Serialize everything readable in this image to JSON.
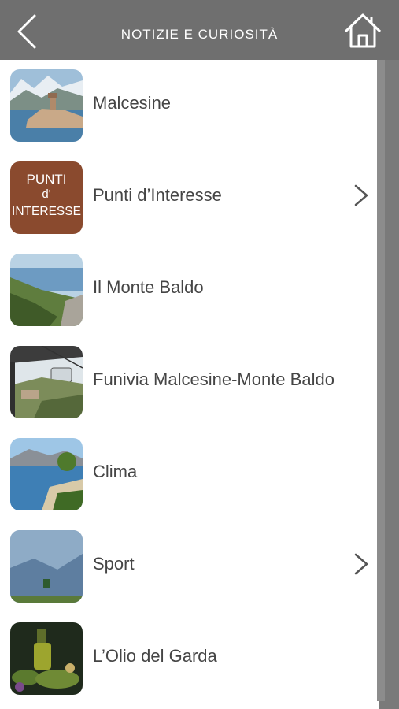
{
  "header": {
    "title": "NOTIZIE E CURIOSITÀ",
    "back_icon": "chevron-left-icon",
    "home_icon": "home-icon"
  },
  "colors": {
    "header_bg": "#6f6f6f",
    "text": "#454545",
    "accent_brown": "#8a4a2e"
  },
  "items": [
    {
      "label": "Malcesine",
      "has_chevron": false
    },
    {
      "label": "Punti d’Interesse",
      "has_chevron": true,
      "thumb_text": [
        "PUNTI",
        "d'",
        "INTERESSE"
      ]
    },
    {
      "label": "Il Monte Baldo",
      "has_chevron": false
    },
    {
      "label": "Funivia Malcesine-Monte Baldo",
      "has_chevron": false
    },
    {
      "label": "Clima",
      "has_chevron": false
    },
    {
      "label": "Sport",
      "has_chevron": true
    },
    {
      "label": "L’Olio del Garda",
      "has_chevron": false
    }
  ]
}
